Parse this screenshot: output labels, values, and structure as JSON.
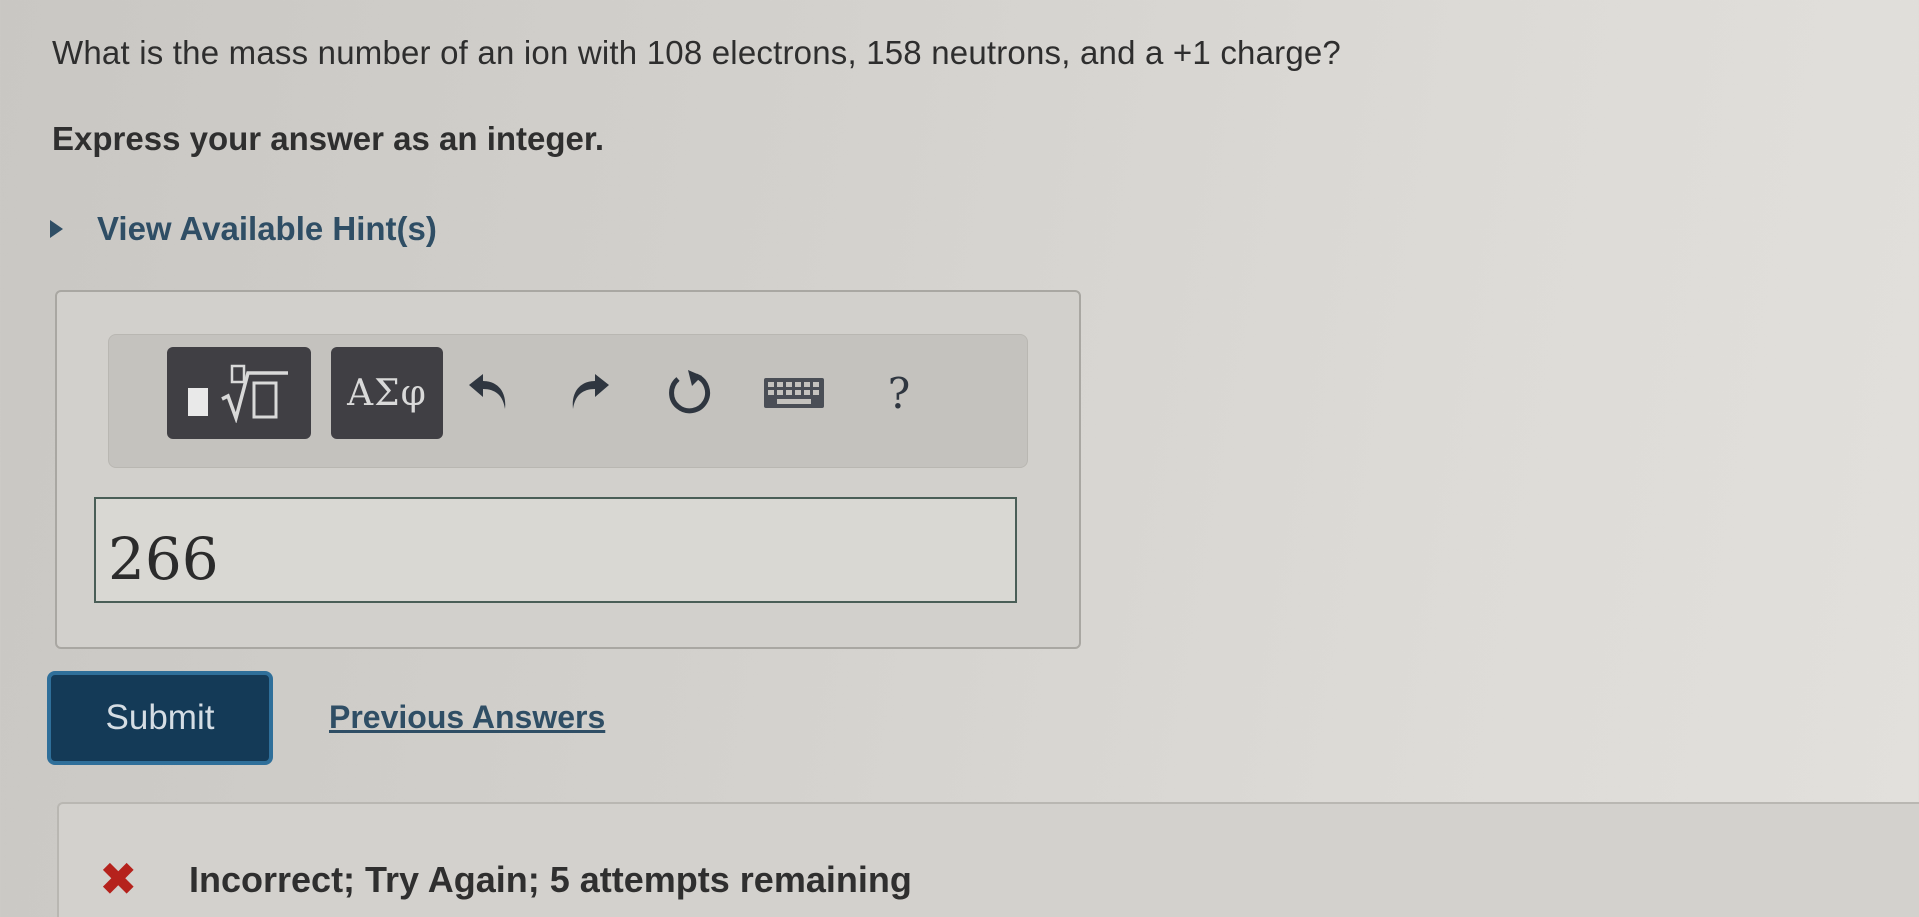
{
  "question": {
    "text": "What is the mass number of an ion with 108 electrons, 158 neutrons, and a +1 charge?",
    "instruction": "Express your answer as an integer."
  },
  "hints": {
    "label": "View Available Hint(s)"
  },
  "toolbar": {
    "symbols_label": "ΑΣφ",
    "help_label": "?",
    "icons": [
      "templates-icon",
      "undo-icon",
      "redo-icon",
      "reset-icon",
      "keyboard-icon",
      "help-icon"
    ]
  },
  "answer": {
    "value": "266"
  },
  "actions": {
    "submit_label": "Submit",
    "previous_answers_label": "Previous Answers"
  },
  "feedback": {
    "status": "incorrect",
    "message": "Incorrect; Try Again; 5 attempts remaining",
    "color": "#b5221c"
  },
  "colors": {
    "accent": "#2f4e65",
    "submit_bg": "#143a57",
    "submit_border": "#2f6f9a",
    "toolbar_button": "#403f44"
  }
}
